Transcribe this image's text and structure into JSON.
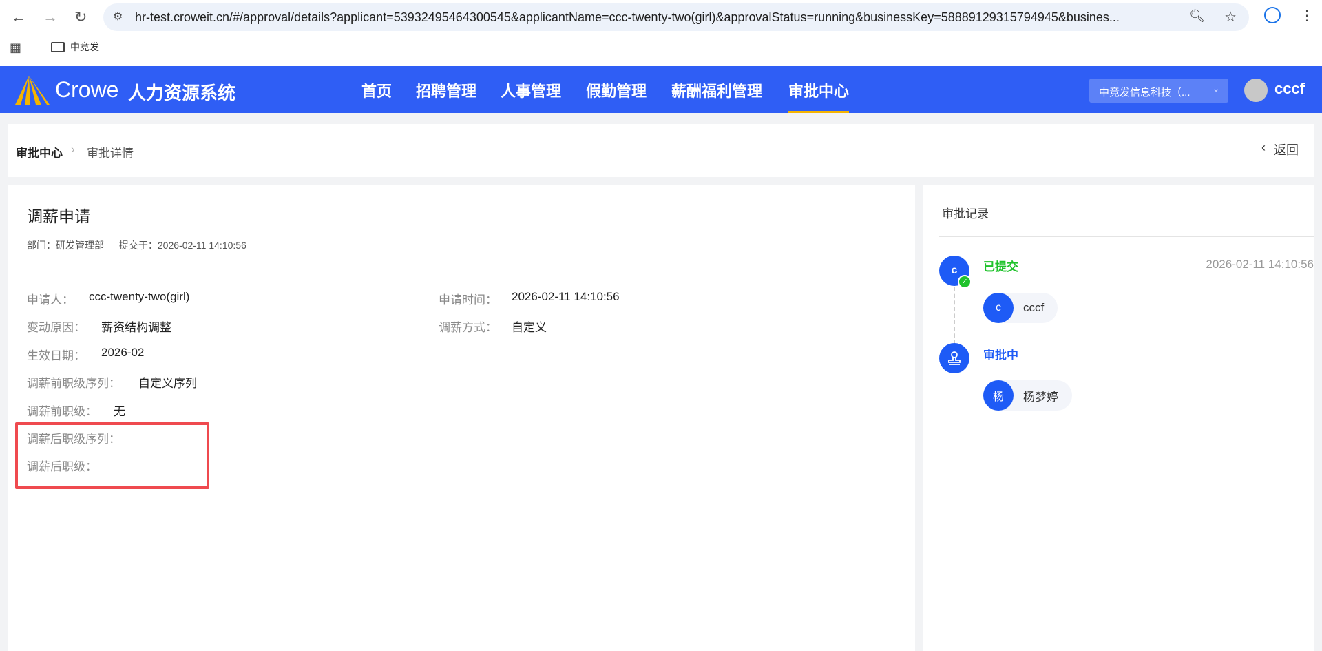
{
  "browser": {
    "url": "hr-test.croweit.cn/#/approval/details?applicant=53932495464300545&applicantName=ccc-twenty-two(girl)&approvalStatus=running&businessKey=58889129315794945&busines...",
    "bookmark": "中竞发"
  },
  "header": {
    "logo": "Crowe",
    "system_name": "人力资源系统",
    "nav": [
      "首页",
      "招聘管理",
      "人事管理",
      "假勤管理",
      "薪酬福利管理",
      "审批中心"
    ],
    "active_nav": 5,
    "company": "中竞发信息科技（...",
    "user": "cccf",
    "accent": "#2f5ef5"
  },
  "breadcrumb": {
    "root": "审批中心",
    "current": "审批详情",
    "back": "返回"
  },
  "detail": {
    "title": "调薪申请",
    "dept_label": "部门：",
    "dept": "研发管理部",
    "submit_label": "提交于：",
    "submit_time": "2026-02-11 14:10:56",
    "fields": [
      {
        "label": "申请人：",
        "value": "ccc-twenty-two(girl)"
      },
      {
        "label": "申请时间：",
        "value": "2026-02-11 14:10:56"
      },
      {
        "label": "变动原因：",
        "value": "薪资结构调整"
      },
      {
        "label": "调薪方式：",
        "value": "自定义"
      },
      {
        "label": "生效日期：",
        "value": "2026-02"
      },
      {
        "label": "调薪前职级序列：",
        "value": "自定义序列"
      },
      {
        "label": "调薪前职级：",
        "value": "无"
      },
      {
        "label": "调薪后职级序列：",
        "value": ""
      },
      {
        "label": "调薪后职级：",
        "value": ""
      }
    ]
  },
  "records": {
    "title": "审批记录",
    "steps": [
      {
        "status": "已提交",
        "avatar": "c",
        "time": "2026-02-11 14:10:56",
        "user_avatar": "c",
        "user": "cccf",
        "color": "#1fc22b"
      },
      {
        "status": "审批中",
        "user_avatar": "杨",
        "user": "杨梦婷",
        "color": "#1e5bf6"
      }
    ]
  }
}
